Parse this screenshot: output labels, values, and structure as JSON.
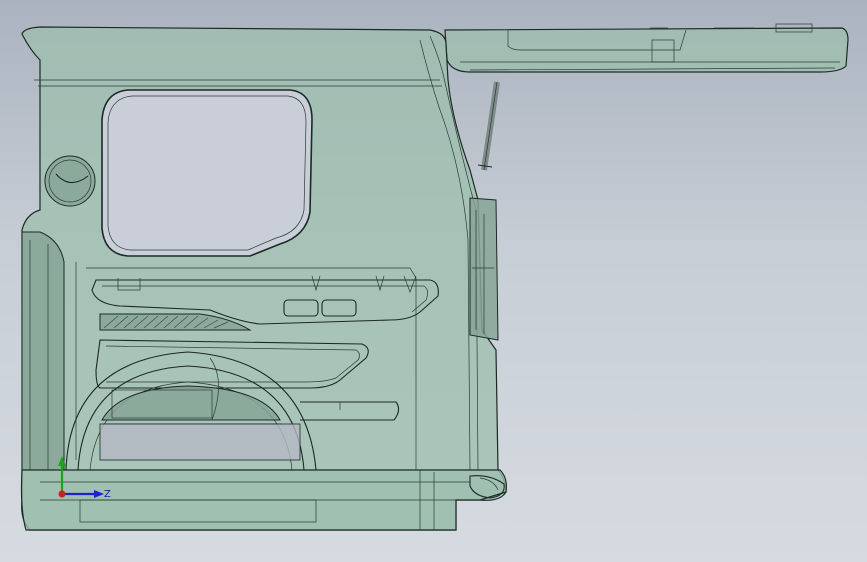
{
  "triad": {
    "z_label": "Z"
  },
  "colors": {
    "background_top": "#aab3bf",
    "background_bottom": "#d6dbe1",
    "body_panel": "#9dbfae",
    "window_glass": "#c9ced8",
    "edge_line": "#1c2a24",
    "axis_x": "#d02020",
    "axis_y": "#20a020",
    "axis_z": "#2020d0"
  }
}
